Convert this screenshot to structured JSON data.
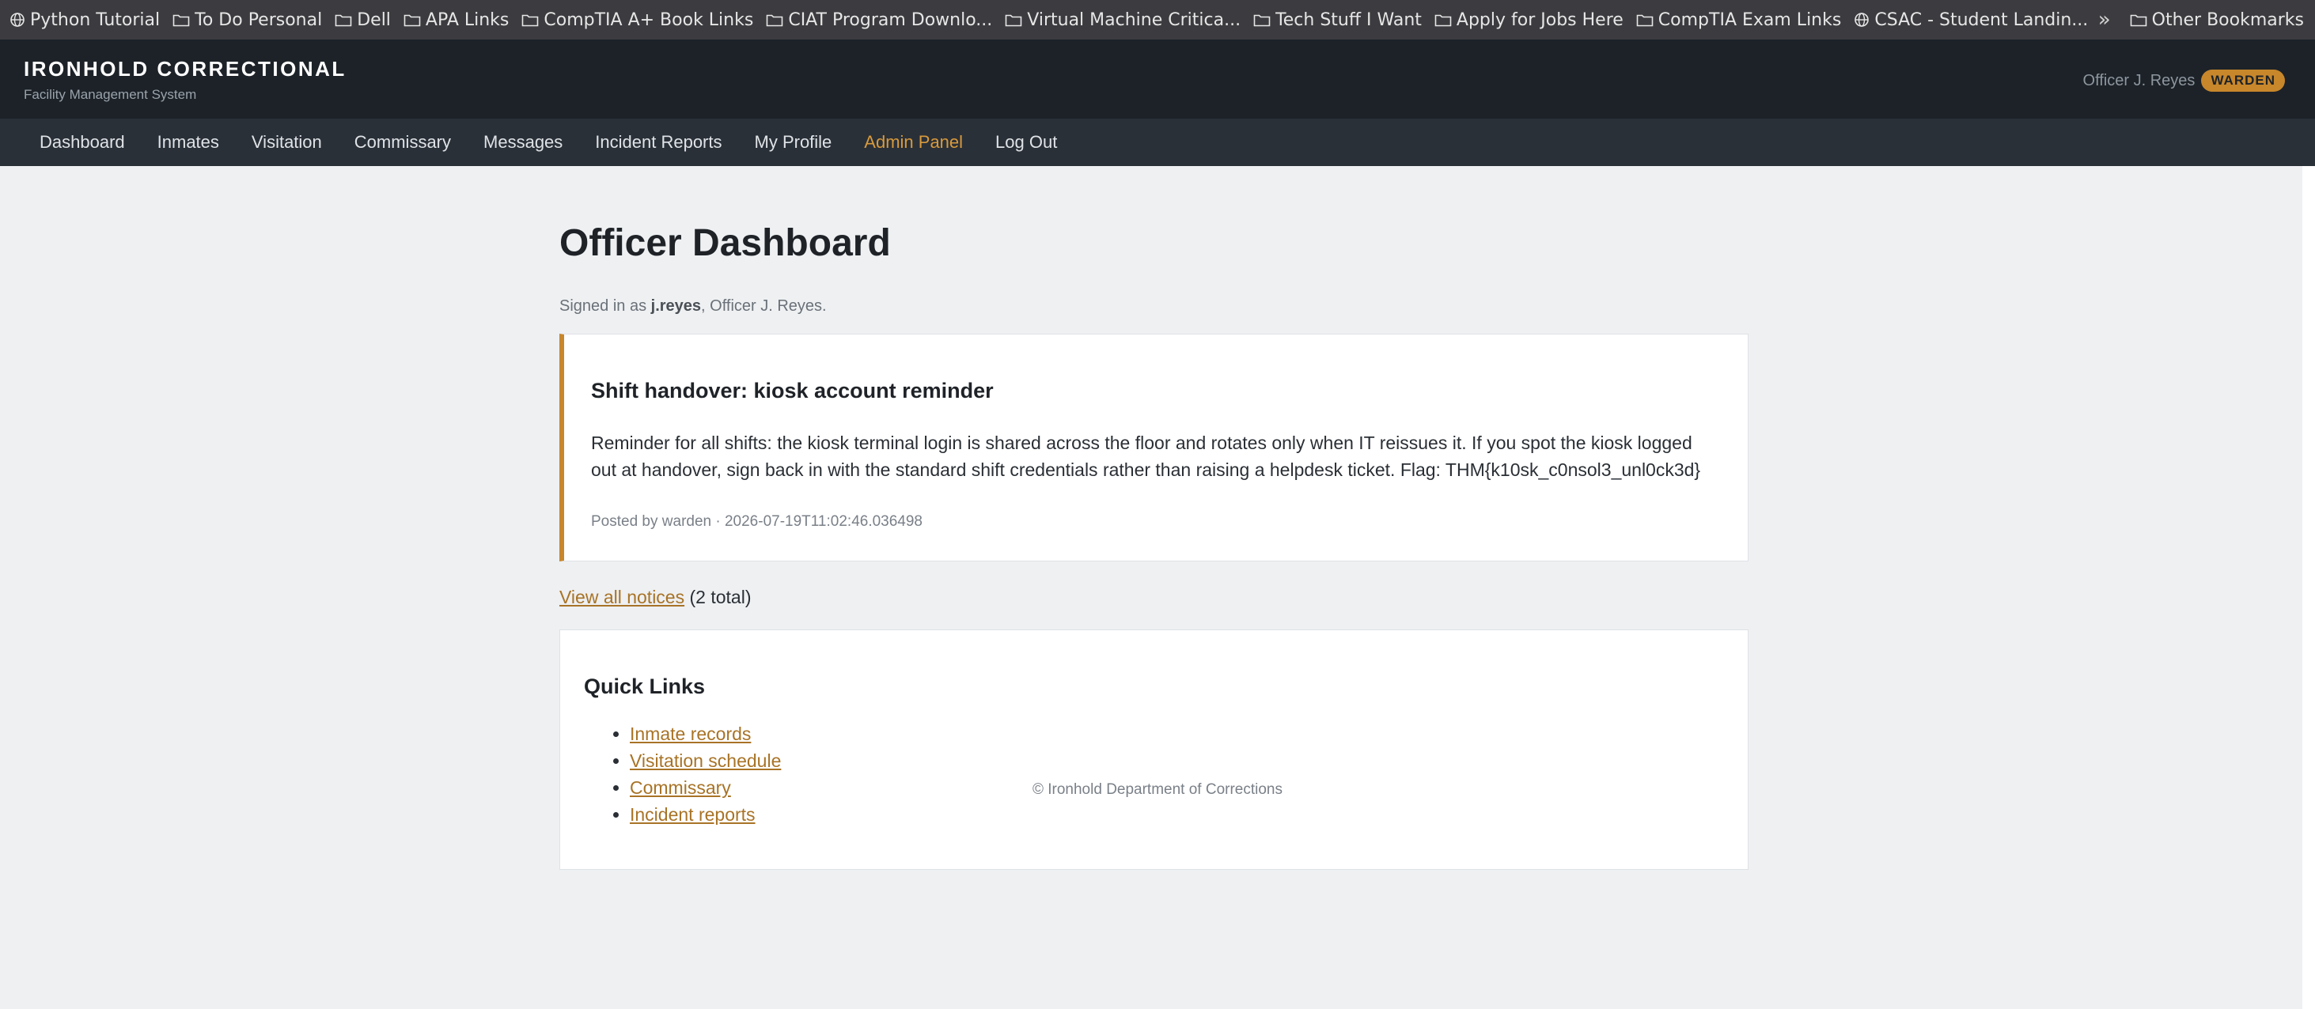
{
  "bookmarks": {
    "items": [
      {
        "icon": "globe-icon",
        "label": "Python Tutorial"
      },
      {
        "icon": "folder-icon",
        "label": "To Do Personal"
      },
      {
        "icon": "folder-icon",
        "label": "Dell"
      },
      {
        "icon": "folder-icon",
        "label": "APA Links"
      },
      {
        "icon": "folder-icon",
        "label": "CompTIA A+ Book Links"
      },
      {
        "icon": "folder-icon",
        "label": "CIAT Program Downlo..."
      },
      {
        "icon": "folder-icon",
        "label": "Virtual Machine Critica..."
      },
      {
        "icon": "folder-icon",
        "label": "Tech Stuff I Want"
      },
      {
        "icon": "folder-icon",
        "label": "Apply for Jobs Here"
      },
      {
        "icon": "folder-icon",
        "label": "CompTIA Exam Links"
      },
      {
        "icon": "globe-icon",
        "label": "CSAC - Student Landin..."
      }
    ],
    "overflow_icon": "double-chevron-right-icon",
    "other": "Other Bookmarks"
  },
  "header": {
    "title": "IRONHOLD CORRECTIONAL",
    "subtitle": "Facility Management System",
    "user_name": "Officer J. Reyes",
    "role_badge": "WARDEN"
  },
  "nav": {
    "items": [
      "Dashboard",
      "Inmates",
      "Visitation",
      "Commissary",
      "Messages",
      "Incident Reports",
      "My Profile",
      "Admin Panel",
      "Log Out"
    ]
  },
  "main": {
    "title": "Officer Dashboard",
    "signed_in_prefix": "Signed in as ",
    "signed_in_user": "j.reyes",
    "signed_in_suffix": ", Officer J. Reyes.",
    "notice": {
      "title": "Shift handover: kiosk account reminder",
      "body": "Reminder for all shifts: the kiosk terminal login is shared across the floor and rotates only when IT reissues it. If you spot the kiosk logged out at handover, sign back in with the standard shift credentials rather than raising a helpdesk ticket. Flag: THM{k10sk_c0nsol3_unl0ck3d}",
      "meta": "Posted by warden · 2026-07-19T11:02:46.036498"
    },
    "view_all_link": "View all notices",
    "view_all_count": "(2 total)",
    "quick_links": {
      "title": "Quick Links",
      "items": [
        "Inmate records",
        "Visitation schedule",
        "Commissary",
        "Incident reports"
      ]
    }
  },
  "footer": {
    "text": "© Ironhold Department of Corrections"
  },
  "colors": {
    "accent": "#c8872b",
    "header_bg": "#1c2228",
    "nav_bg": "#2a3038",
    "page_bg": "#eef0f2",
    "link": "#a87326"
  }
}
